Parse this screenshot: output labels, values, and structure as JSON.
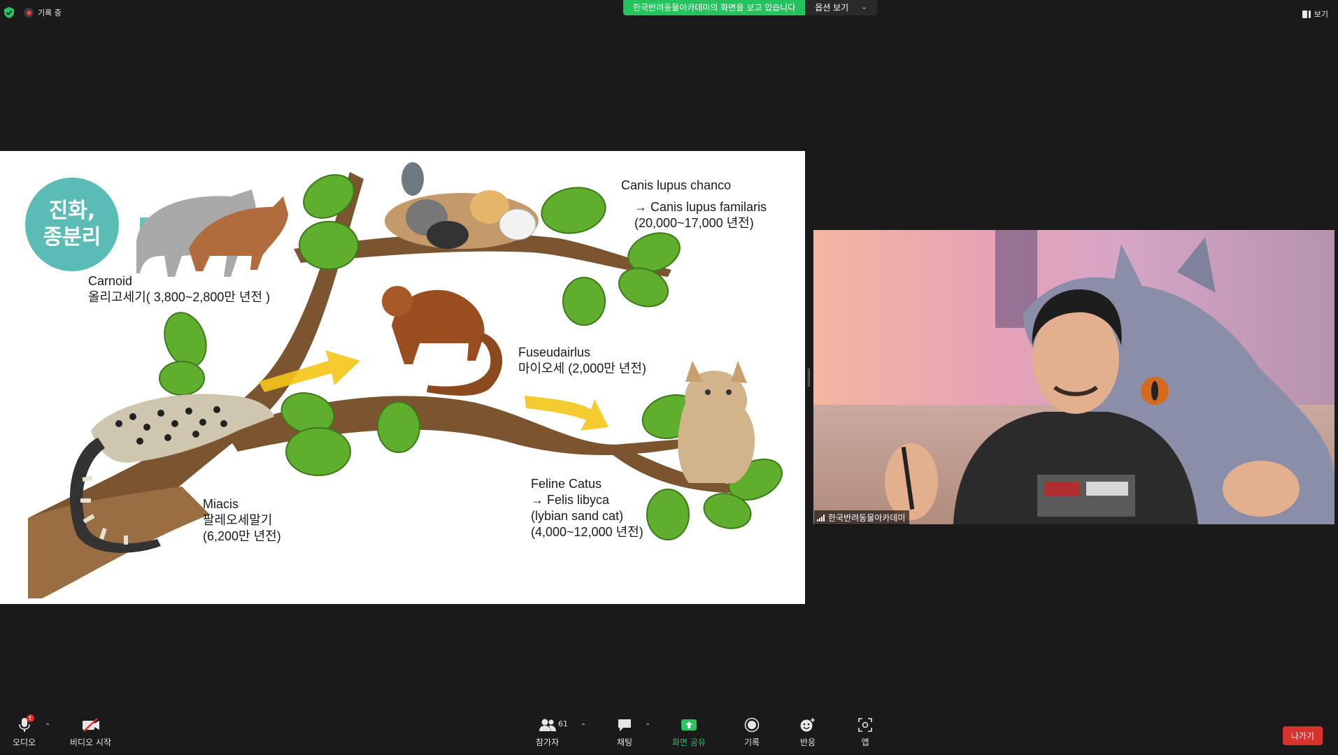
{
  "topbar": {
    "recording_label": "기록 중",
    "share_banner": "한국반려동물아카데미의 화면을 보고 있습니다",
    "view_options": "옵션 보기",
    "view_label": "보기"
  },
  "slide": {
    "badge": "진화,\n종분리",
    "carnoid": "Carnoid\n올리고세기( 3,800~2,800만 년전 )",
    "canis": "Canis lupus chanco",
    "canis_familiaris": "→ Canis lupus familaris\n(20,000~17,000 년전)",
    "fuseudairlus": "Fuseudairlus\n마이오세 (2,000만 년전)",
    "miacis": "Miacis\n팔레오세말기\n(6,200만 년전)",
    "feline": "Feline Catus\n→ Felis libyca\n(lybian sand cat)\n(4,000~12,000 년전)"
  },
  "video": {
    "participant_name": "한국반려동물아카데미"
  },
  "toolbar": {
    "audio": "오디오",
    "video_start": "비디오 시작",
    "participants": "참가자",
    "participant_count": "61",
    "chat": "채팅",
    "share_screen": "화면 공유",
    "record": "기록",
    "reactions": "반응",
    "apps": "앱",
    "leave": "나가기"
  },
  "colors": {
    "share_green": "#25c35e",
    "leave_red": "#d9322e",
    "badge_teal": "#5bbcb5",
    "leaf_green": "#5fae2e",
    "branch_brown": "#7a5530"
  }
}
